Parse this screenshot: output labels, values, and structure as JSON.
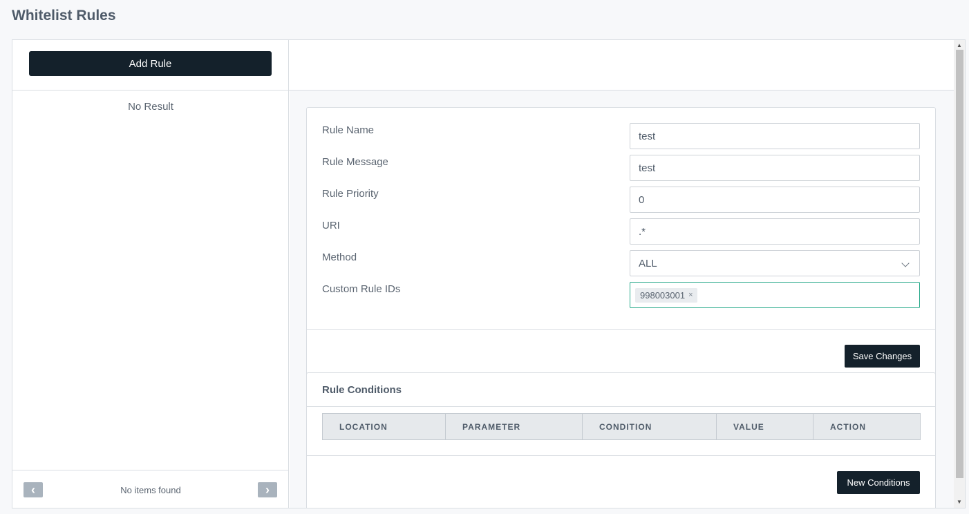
{
  "page": {
    "title": "Whitelist Rules"
  },
  "left_panel": {
    "add_rule_label": "Add Rule",
    "empty_text": "No Result",
    "footer": {
      "status": "No items found",
      "prev_icon": "‹",
      "next_icon": "›"
    }
  },
  "form": {
    "fields": [
      {
        "label": "Rule Name",
        "value": "test"
      },
      {
        "label": "Rule Message",
        "value": "test"
      },
      {
        "label": "Rule Priority",
        "value": "0"
      },
      {
        "label": "URI",
        "value": ".*"
      },
      {
        "label": "Method",
        "value": "ALL"
      },
      {
        "label": "Custom Rule IDs",
        "tags": [
          "998003001"
        ]
      }
    ],
    "tag_remove_icon": "×",
    "save_label": "Save Changes"
  },
  "conditions": {
    "title": "Rule Conditions",
    "columns": [
      "LOCATION",
      "PARAMETER",
      "CONDITION",
      "VALUE",
      "ACTION"
    ],
    "new_label": "New Conditions"
  },
  "colors": {
    "primary_button": "#14212b",
    "focus_border": "#27a98a",
    "page_background": "#f7f8fa"
  }
}
